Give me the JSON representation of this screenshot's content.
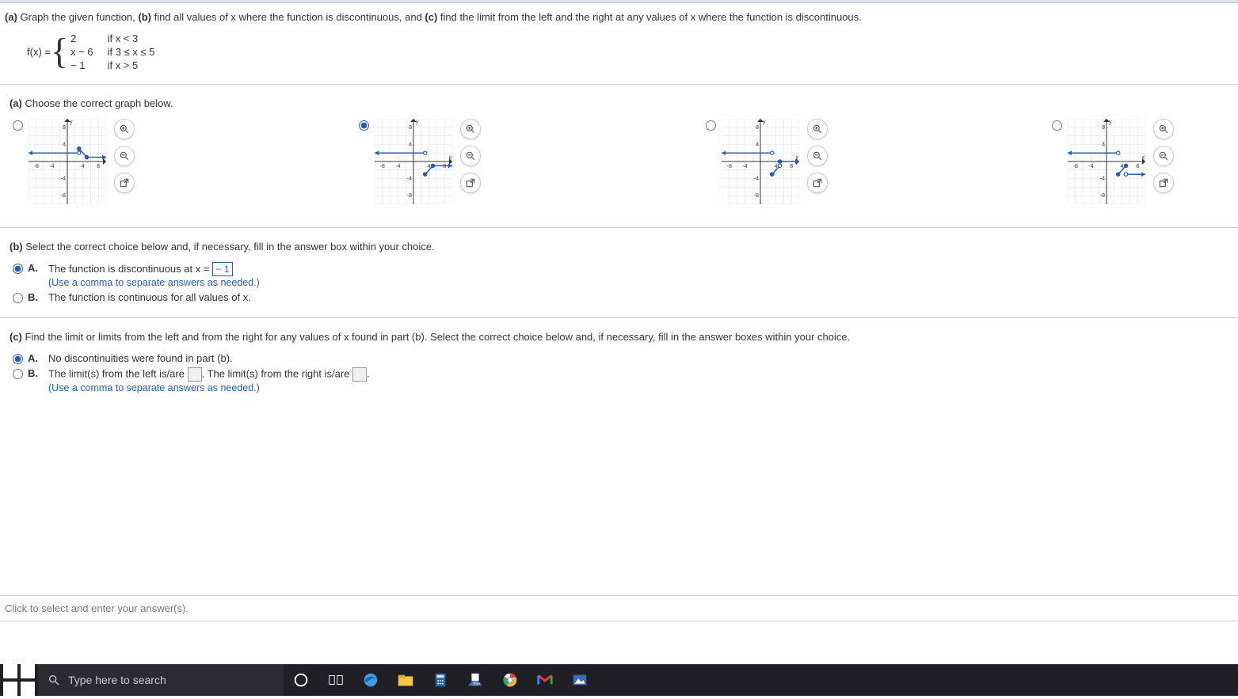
{
  "question": {
    "intro_a": "(a)",
    "intro_a_text": " Graph the given function, ",
    "intro_b": "(b)",
    "intro_b_text": " find all values of x where the function is discontinuous, and ",
    "intro_c": "(c)",
    "intro_c_text": " find the limit from the left and the right at any values of x where the function is discontinuous.",
    "fx_left": "f(x) = ",
    "piece1_val": "2",
    "piece1_cond": "if x < 3",
    "piece2_val": "x − 6",
    "piece2_cond": "if 3 ≤ x ≤ 5",
    "piece3_val": "− 1",
    "piece3_cond": "if x > 5"
  },
  "partA": {
    "label": "(a)",
    "text": " Choose the correct graph below."
  },
  "partB": {
    "label": "(b)",
    "text": " Select the correct choice below and, if necessary, fill in the answer box within your choice.",
    "choiceA_label": "A.",
    "choiceA_text_pre": "The function is discontinuous at x = ",
    "choiceA_answer": "− 1",
    "choiceA_instr": "(Use a comma to separate answers as needed.)",
    "choiceB_label": "B.",
    "choiceB_text": "The function is continuous for all values of x."
  },
  "partC": {
    "label": "(c)",
    "text": " Find the limit or limits from the left and from the right for any values of x found in part (b). Select the correct choice below and, if necessary, fill in the answer boxes within your choice.",
    "choiceA_label": "A.",
    "choiceA_text": "No discontinuities were found in part (b).",
    "choiceB_label": "B.",
    "choiceB_text1": "The limit(s) from the left is/are ",
    "choiceB_text2": ". The limit(s) from the right is/are ",
    "choiceB_text3": ".",
    "choiceB_instr": "(Use a comma to separate answers as needed.)"
  },
  "footer_hint": "Click to select and enter your answer(s).",
  "taskbar": {
    "search_placeholder": "Type here to search"
  },
  "chart_data": [
    {
      "type": "line",
      "title": "Option 1",
      "xlim": [
        -10,
        10
      ],
      "ylim": [
        -10,
        10
      ],
      "xticks": [
        -8,
        -4,
        4,
        8
      ],
      "yticks": [
        -8,
        -4,
        4,
        8
      ],
      "series": [
        {
          "name": "left-ray",
          "points": [
            [
              -10,
              2
            ],
            [
              3,
              2
            ]
          ],
          "style": "arrow-left,open-end"
        },
        {
          "name": "mid-seg",
          "points": [
            [
              3,
              3
            ],
            [
              5,
              1
            ]
          ],
          "style": "closed-start,closed-end"
        },
        {
          "name": "right-ray",
          "points": [
            [
              5,
              1
            ],
            [
              10,
              1
            ]
          ],
          "style": "arrow-right"
        }
      ]
    },
    {
      "type": "line",
      "title": "Option 2 (selected)",
      "xlim": [
        -10,
        10
      ],
      "ylim": [
        -10,
        10
      ],
      "xticks": [
        -8,
        -4,
        4,
        8
      ],
      "yticks": [
        -8,
        -4,
        4,
        8
      ],
      "series": [
        {
          "name": "left-ray",
          "points": [
            [
              -10,
              2
            ],
            [
              3,
              2
            ]
          ],
          "style": "arrow-left,open-end"
        },
        {
          "name": "mid-seg",
          "points": [
            [
              3,
              -3
            ],
            [
              5,
              -1
            ]
          ],
          "style": "closed-start,closed-end"
        },
        {
          "name": "right-ray",
          "points": [
            [
              5,
              -1
            ],
            [
              10,
              -1
            ]
          ],
          "style": "arrow-right"
        }
      ]
    },
    {
      "type": "line",
      "title": "Option 3",
      "xlim": [
        -10,
        10
      ],
      "ylim": [
        -10,
        10
      ],
      "xticks": [
        -8,
        -4,
        4,
        8
      ],
      "yticks": [
        -8,
        -4,
        4,
        8
      ],
      "series": [
        {
          "name": "left-ray",
          "points": [
            [
              -10,
              2
            ],
            [
              3,
              2
            ]
          ],
          "style": "arrow-left,open-end"
        },
        {
          "name": "mid-seg",
          "points": [
            [
              3,
              -3
            ],
            [
              5,
              -1
            ]
          ],
          "style": "closed-start,open-end"
        },
        {
          "name": "right-ray",
          "points": [
            [
              5,
              0
            ],
            [
              10,
              0
            ]
          ],
          "style": "arrow-right,closed-start"
        }
      ]
    },
    {
      "type": "line",
      "title": "Option 4",
      "xlim": [
        -10,
        10
      ],
      "ylim": [
        -10,
        10
      ],
      "xticks": [
        -8,
        -4,
        4,
        8
      ],
      "yticks": [
        -8,
        -4,
        4,
        8
      ],
      "series": [
        {
          "name": "left-ray",
          "points": [
            [
              -10,
              2
            ],
            [
              3,
              2
            ]
          ],
          "style": "arrow-left,open-end"
        },
        {
          "name": "mid-seg",
          "points": [
            [
              3,
              -3
            ],
            [
              5,
              -1
            ]
          ],
          "style": "closed-start,closed-end"
        },
        {
          "name": "right-ray",
          "points": [
            [
              5,
              -3
            ],
            [
              10,
              -3
            ]
          ],
          "style": "arrow-right,open-start"
        }
      ]
    }
  ]
}
